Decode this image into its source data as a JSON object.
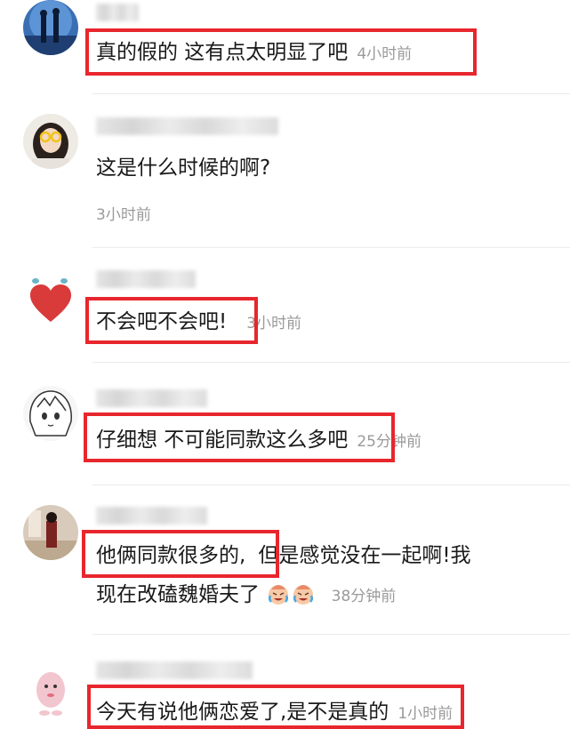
{
  "comments": [
    {
      "text": "真的假的 这有点太明显了吧",
      "time": "4小时前"
    },
    {
      "text": "这是什么时候的啊?",
      "time": "3小时前"
    },
    {
      "text": "不会吧不会吧!",
      "time": "3小时前"
    },
    {
      "text": "仔细想 不可能同款这么多吧",
      "time": "25分钟前"
    },
    {
      "text_highlight": "他俩同款很多的,",
      "text_rest": "但是感觉没在一起啊!我",
      "text_line2": "现在改磕魏婚夫了",
      "time": "38分钟前"
    },
    {
      "text": "今天有说他俩恋爱了,是不是真的",
      "time": "1小时前"
    }
  ],
  "colors": {
    "highlight_box": "#e8262d",
    "time_text": "#9a9a9a",
    "divider": "#ebebeb"
  }
}
